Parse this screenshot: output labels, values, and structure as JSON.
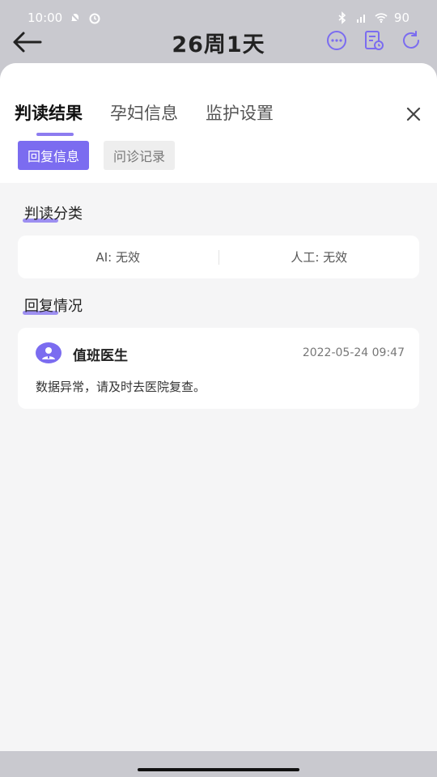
{
  "status_bar": {
    "time": "10:00",
    "battery": "90"
  },
  "header": {
    "title": "26周1天"
  },
  "tabs": [
    {
      "label": "判读结果",
      "active": true
    },
    {
      "label": "孕妇信息",
      "active": false
    },
    {
      "label": "监护设置",
      "active": false
    }
  ],
  "chips": {
    "primary": "回复信息",
    "secondary": "问诊记录"
  },
  "classification": {
    "title": "判读分类",
    "ai": "AI: 无效",
    "manual": "人工: 无效"
  },
  "reply": {
    "title": "回复情况",
    "doctor": "值班医生",
    "time": "2022-05-24 09:47",
    "message": "数据异常，请及时去医院复查。"
  },
  "colors": {
    "accent": "#7b6cf0",
    "underline": "#8d7cf0",
    "background": "#f5f5f6"
  }
}
